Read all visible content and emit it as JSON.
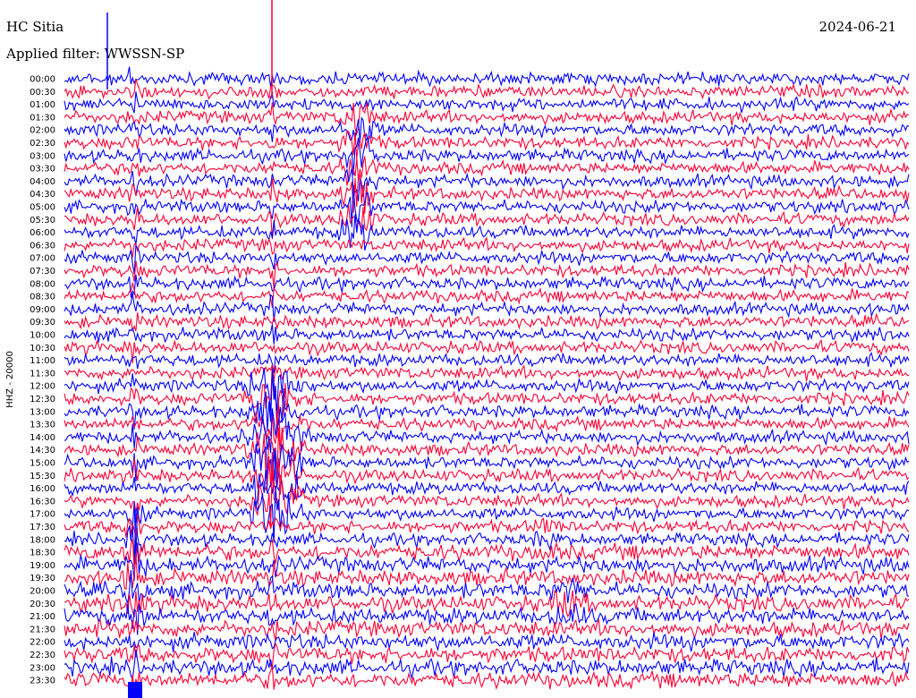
{
  "header": {
    "station": "HC Sitia",
    "date": "2024-06-21",
    "filter_label": "Applied filter:",
    "filter_value": "WWSSN-SP"
  },
  "chart_data": {
    "type": "line",
    "title": "HC Sitia",
    "ylabel": "HHZ - 20000",
    "row_labels": [
      "00:00",
      "00:30",
      "01:00",
      "01:30",
      "02:00",
      "02:30",
      "03:00",
      "03:30",
      "04:00",
      "04:30",
      "05:00",
      "05:30",
      "06:00",
      "06:30",
      "07:00",
      "07:30",
      "08:00",
      "08:30",
      "09:00",
      "09:30",
      "10:00",
      "10:30",
      "11:00",
      "11:30",
      "12:00",
      "12:30",
      "13:00",
      "13:30",
      "14:00",
      "14:30",
      "15:00",
      "15:30",
      "16:00",
      "16:30",
      "17:00",
      "17:30",
      "18:00",
      "18:30",
      "19:00",
      "19:30",
      "20:00",
      "20:30",
      "21:00",
      "21:30",
      "22:00",
      "22:30",
      "23:00",
      "23:30"
    ],
    "minutes_per_row": 30,
    "colors": [
      "#0000ff",
      "#ff0033"
    ]
  }
}
